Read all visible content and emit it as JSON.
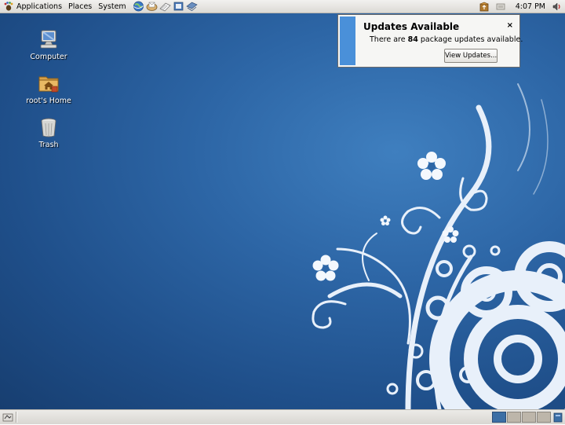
{
  "top_panel": {
    "menus": [
      {
        "label": "Applications",
        "icon": "gnome-foot-icon"
      },
      {
        "label": "Places"
      },
      {
        "label": "System"
      }
    ],
    "launchers": [
      "web-browser-icon",
      "mail-client-icon",
      "text-editor-icon",
      "notes-icon",
      "help-icon"
    ],
    "tray_icons": [
      "update-notifier-icon",
      "network-icon"
    ],
    "clock": "4:07 PM",
    "volume_icon": "volume-icon"
  },
  "desktop": {
    "icons": [
      {
        "label": "Computer",
        "icon": "computer-icon"
      },
      {
        "label": "root's Home",
        "icon": "home-folder-icon"
      },
      {
        "label": "Trash",
        "icon": "trash-icon"
      }
    ]
  },
  "notification": {
    "title": "Updates Available",
    "message_prefix": "There are ",
    "count": "84",
    "message_suffix": " package updates available.",
    "button": "View Updates...",
    "close": "×",
    "accent": "#4a90d9"
  },
  "bottom_panel": {
    "show_desktop_icon": "show-desktop-icon",
    "workspaces": 4,
    "active_workspace": 1
  },
  "colors": {
    "panel": "#e4e2de",
    "desktop_blue": "#2d66a6"
  }
}
